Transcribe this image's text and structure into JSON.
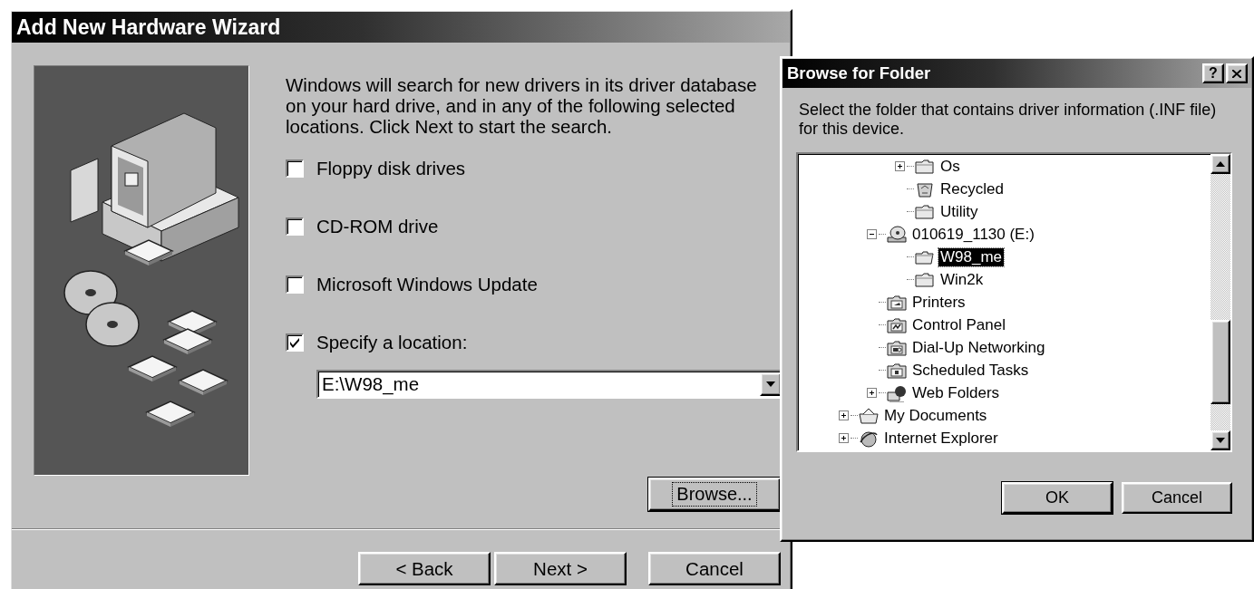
{
  "wizard": {
    "title": "Add New Hardware Wizard",
    "intro": "Windows will search for new drivers in its driver database on your hard drive, and in any of the following selected locations. Click Next to start the search.",
    "options": [
      {
        "label": "Floppy disk drives",
        "checked": false
      },
      {
        "label": "CD-ROM drive",
        "checked": false
      },
      {
        "label": "Microsoft Windows Update",
        "checked": false
      },
      {
        "label": "Specify a location:",
        "checked": true
      }
    ],
    "location": {
      "value": "E:\\W98_me"
    },
    "browse_button": {
      "label": "Browse...",
      "focused": true
    },
    "buttons": [
      {
        "label": "< Back"
      },
      {
        "label": "Next >"
      },
      {
        "label": "Cancel"
      }
    ]
  },
  "browse_dialog": {
    "title": "Browse for Folder",
    "help_button": "?",
    "description": "Select the folder that contains driver information (.INF file) for this device.",
    "tree": [
      {
        "children": [
          {
            "children": [
              {
                "label": "Os",
                "kind": "folder",
                "expanded": false,
                "selected": false
              },
              {
                "label": "Recycled",
                "kind": "recycle-bin",
                "selected": false
              },
              {
                "label": "Utility",
                "kind": "folder",
                "selected": false
              }
            ]
          },
          {
            "label": "010619_1130 (E:)",
            "kind": "cd-drive",
            "expanded": true,
            "selected": false,
            "children": [
              {
                "label": "W98_me",
                "kind": "folder",
                "selected": true
              },
              {
                "label": "Win2k",
                "kind": "folder",
                "selected": false
              }
            ]
          },
          {
            "label": "Printers",
            "kind": "printers",
            "selected": false
          },
          {
            "label": "Control Panel",
            "kind": "control-panel",
            "selected": false
          },
          {
            "label": "Dial-Up Networking",
            "kind": "dial-up",
            "selected": false
          },
          {
            "label": "Scheduled Tasks",
            "kind": "tasks",
            "selected": false
          },
          {
            "label": "Web Folders",
            "kind": "web",
            "expanded": false,
            "selected": false
          }
        ]
      },
      {
        "label": "My Documents",
        "kind": "documents",
        "expanded": false,
        "selected": false
      },
      {
        "label": "Internet Explorer",
        "kind": "browser",
        "expanded": false,
        "selected": false
      }
    ],
    "buttons": [
      {
        "label": "OK",
        "default": true
      },
      {
        "label": "Cancel",
        "default": false
      }
    ]
  }
}
